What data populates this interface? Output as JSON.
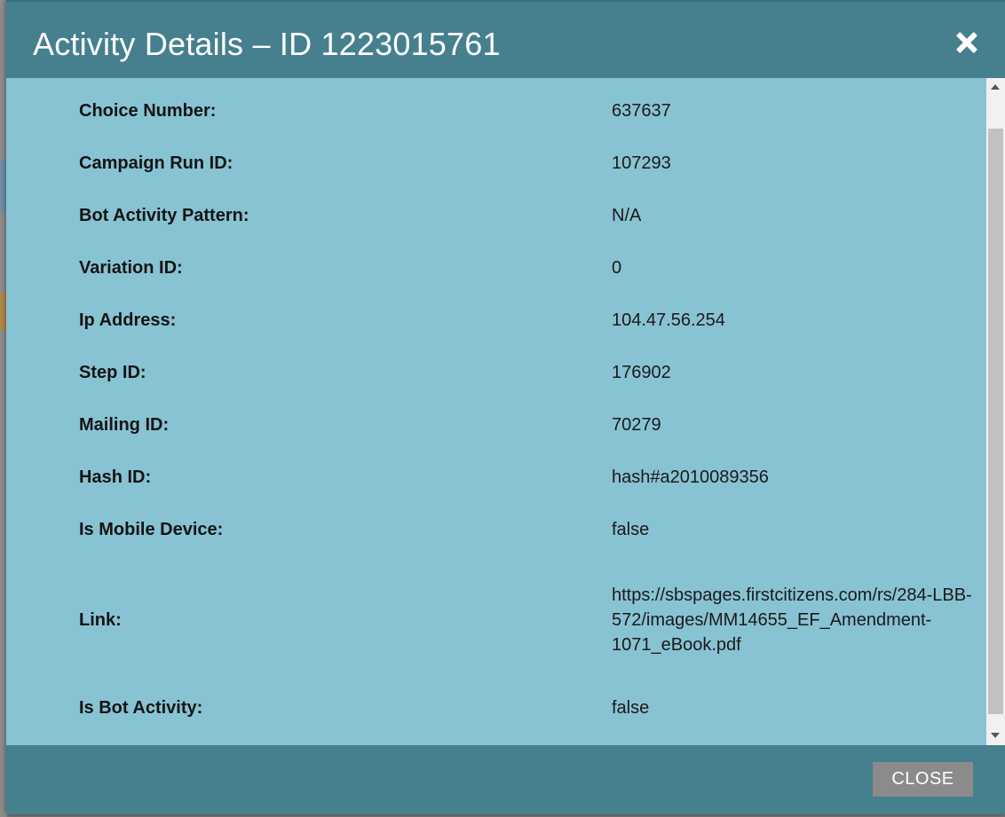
{
  "dialog": {
    "title": "Activity Details – ID 1223015761",
    "close_icon": "close-icon",
    "close_button_label": "CLOSE"
  },
  "details": [
    {
      "label": "Choice Number:",
      "value": "637637"
    },
    {
      "label": "Campaign Run ID:",
      "value": "107293"
    },
    {
      "label": "Bot Activity Pattern:",
      "value": "N/A"
    },
    {
      "label": "Variation ID:",
      "value": "0"
    },
    {
      "label": "Ip Address:",
      "value": "104.47.56.254"
    },
    {
      "label": "Step ID:",
      "value": "176902"
    },
    {
      "label": "Mailing ID:",
      "value": "70279"
    },
    {
      "label": "Hash ID:",
      "value": "hash#a2010089356"
    },
    {
      "label": "Is Mobile Device:",
      "value": "false"
    },
    {
      "label": "Link:",
      "value": "https://sbspages.firstcitizens.com/rs/284-LBB-572/images/MM14655_EF_Amendment-1071_eBook.pdf"
    },
    {
      "label": "Is Bot Activity:",
      "value": "false"
    }
  ],
  "colors": {
    "header": "#46808f",
    "body": "#88c3d3",
    "close_button": "#8b8b8b"
  }
}
